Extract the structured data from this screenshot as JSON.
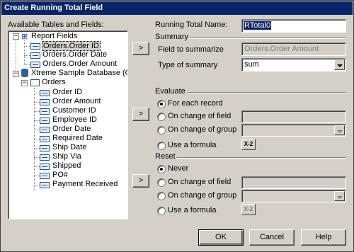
{
  "window": {
    "title": "Create Running Total Field"
  },
  "left": {
    "available_label": "Available Tables and Fields:",
    "tree": {
      "report_fields": "Report Fields",
      "report_items": [
        "Orders.Order ID",
        "Orders.Order Date",
        "Orders.Order Amount"
      ],
      "database": "Xtreme Sample Database (ODBC (",
      "orders_table": "Orders",
      "order_fields": [
        "Order ID",
        "Order Amount",
        "Customer ID",
        "Employee ID",
        "Order Date",
        "Required Date",
        "Ship Date",
        "Ship Via",
        "Shipped",
        "PO#",
        "Payment Received"
      ]
    }
  },
  "arrows": {
    "summary": ">",
    "evaluate": ">",
    "reset": ">"
  },
  "right": {
    "running_total_name_label": "Running Total Name:",
    "running_total_name_value": "RTotal0",
    "summary_header": "Summary",
    "field_to_summarize_label": "Field to summarize",
    "field_to_summarize_value": "Orders.Order Amount",
    "type_of_summary_label": "Type of summary",
    "type_of_summary_value": "sum",
    "evaluate_header": "Evaluate",
    "evaluate_options": [
      "For each record",
      "On change of field",
      "On change of group",
      "Use a formula"
    ],
    "reset_header": "Reset",
    "reset_options": [
      "Never",
      "On change of field",
      "On change of group",
      "Use a formula"
    ],
    "formula_icon": "X-2"
  },
  "buttons": {
    "ok": "OK",
    "cancel": "Cancel",
    "help": "Help"
  }
}
